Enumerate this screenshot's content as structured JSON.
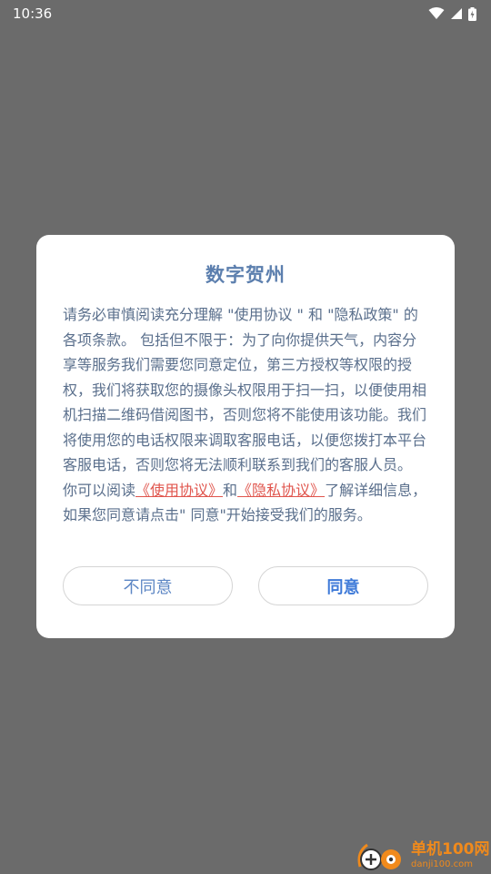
{
  "status_bar": {
    "time": "10:36",
    "icons": [
      "wifi-icon",
      "signal-icon",
      "battery-icon"
    ]
  },
  "dialog": {
    "title": "数字贺州",
    "paragraph1": "请务必审慎阅读充分理解 \"使用协议 \" 和 \"隐私政策\" 的各项条款。 包括但不限于：为了向你提供天气，内容分享等服务我们需要您同意定位，第三方授权等权限的授权，我们将获取您的摄像头权限用于扫一扫，以便使用相机扫描二维码借阅图书，否则您将不能使用该功能。我们将使用您的电话权限来调取客服电话，以便您拨打本平台客服电话，否则您将无法顺利联系到我们的客服人员。",
    "p2_prefix": "你可以阅读",
    "link_usage": "《使用协议》",
    "p2_and": "和",
    "link_privacy": "《隐私协议》",
    "p2_suffix": "了解详细信息，如果您同意请点击\" 同意\"开始接受我们的服务。",
    "disagree_label": "不同意",
    "agree_label": "同意"
  },
  "watermark": {
    "main": "单机100网",
    "sub": "danji100.com"
  },
  "colors": {
    "overlay": "#6b6b6b",
    "title": "#5c7fae",
    "body_text": "#5a6f8c",
    "link": "#e0554d",
    "agree": "#3d79d8"
  }
}
